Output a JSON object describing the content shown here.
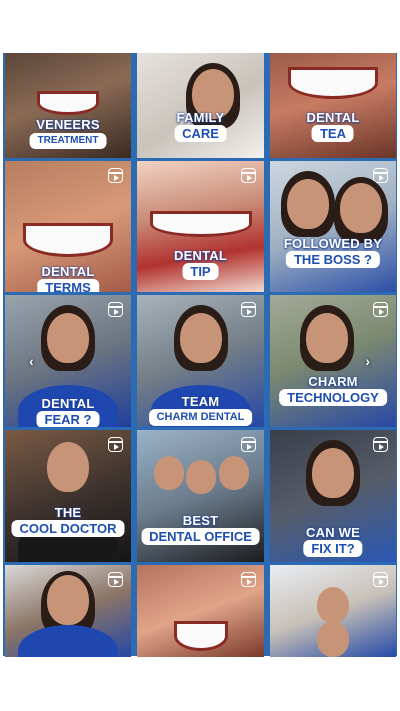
{
  "tiles": [
    {
      "title": "VENEERS",
      "pill": "TREATMENT",
      "reel": false
    },
    {
      "title": "FAMILY",
      "pill": "CARE",
      "reel": false
    },
    {
      "title": "DENTAL",
      "pill": "TEA",
      "reel": false
    },
    {
      "title": "DENTAL",
      "pill": "TERMS",
      "reel": true
    },
    {
      "title": "DENTAL",
      "pill": "TIP",
      "reel": true
    },
    {
      "title": "FOLLOWED BY",
      "pill": "THE BOSS ?",
      "reel": true
    },
    {
      "title": "DENTAL",
      "pill": "FEAR ?",
      "reel": true
    },
    {
      "title": "TEAM",
      "pill": "CHARM DENTAL",
      "reel": true
    },
    {
      "title": "CHARM",
      "pill": "TECHNOLOGY",
      "reel": true
    },
    {
      "title": "THE",
      "pill": "COOL DOCTOR",
      "reel": true
    },
    {
      "title": "BEST",
      "pill": "DENTAL OFFICE",
      "reel": true
    },
    {
      "title": "CAN WE",
      "pill": "FIX IT?",
      "reel": true
    },
    {
      "title": "",
      "pill": "",
      "reel": true
    },
    {
      "title": "",
      "pill": "",
      "reel": true
    },
    {
      "title": "",
      "pill": "",
      "reel": true
    }
  ],
  "carousel": {
    "prev": "‹",
    "next": "›"
  },
  "icons": {
    "reel": "reel-icon"
  },
  "colors": {
    "accent": "#1f4fb0",
    "divider": "#2a6bb3"
  }
}
